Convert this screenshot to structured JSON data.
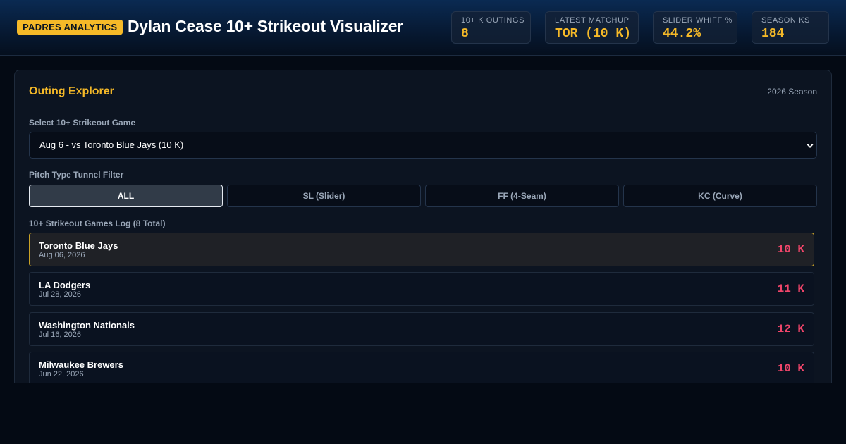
{
  "header": {
    "brand": "PADRES ANALYTICS",
    "title": "Dylan Cease 10+ Strikeout Visualizer",
    "stats": [
      {
        "label": "10+ K OUTINGS",
        "value": "8"
      },
      {
        "label": "LATEST MATCHUP",
        "value": "TOR (10 K)"
      },
      {
        "label": "SLIDER WHIFF %",
        "value": "44.2%"
      },
      {
        "label": "SEASON KS",
        "value": "184"
      }
    ]
  },
  "explorer": {
    "title": "Outing Explorer",
    "season": "2026 Season",
    "select_label": "Select 10+ Strikeout Game",
    "selected_game": "Aug 6 - vs Toronto Blue Jays (10 K)",
    "filter_label": "Pitch Type Tunnel Filter",
    "filters": [
      "ALL",
      "SL (Slider)",
      "FF (4-Seam)",
      "KC (Curve)"
    ],
    "log_label": "10+ Strikeout Games Log (8 Total)",
    "games": [
      {
        "team": "Toronto Blue Jays",
        "date": "Aug 06, 2026",
        "k": "10 K"
      },
      {
        "team": "LA Dodgers",
        "date": "Jul 28, 2026",
        "k": "11 K"
      },
      {
        "team": "Washington Nationals",
        "date": "Jul 16, 2026",
        "k": "12 K"
      },
      {
        "team": "Milwaukee Brewers",
        "date": "Jun 22, 2026",
        "k": "10 K"
      }
    ]
  },
  "colors": {
    "accent": "#f5b928",
    "strikeout": "#f0456a",
    "background": "#040a14"
  }
}
